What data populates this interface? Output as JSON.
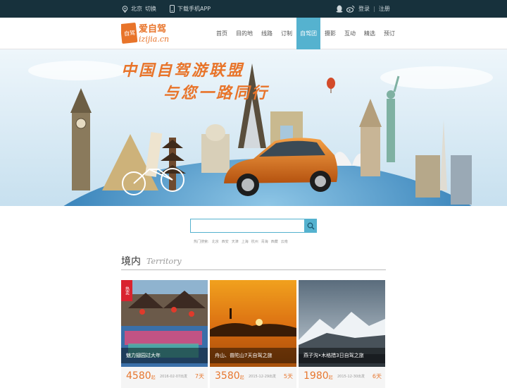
{
  "topbar": {
    "city": "北京",
    "switch": "切换",
    "app": "下载手机APP",
    "login": "登录",
    "divider": "|",
    "register": "注册"
  },
  "logo": {
    "cn": "爱自驾",
    "en": "izijia.cn",
    "badge": "自驾介"
  },
  "nav": {
    "items": [
      {
        "label": "首页",
        "active": false
      },
      {
        "label": "目的地",
        "active": false
      },
      {
        "label": "线路",
        "active": false
      },
      {
        "label": "订制",
        "active": false
      },
      {
        "label": "自驾团",
        "active": true
      },
      {
        "label": "摄影",
        "active": false
      },
      {
        "label": "互动",
        "active": false
      },
      {
        "label": "精选",
        "active": false
      },
      {
        "label": "预订",
        "active": false
      }
    ]
  },
  "banner": {
    "line1": "中国自驾游联盟",
    "line2": "与您一路同行"
  },
  "search": {
    "value": "",
    "placeholder": "",
    "hot_label": "热门搜索:",
    "hot_items": [
      "北京",
      "西安",
      "天津",
      "上海",
      "杭州",
      "青海",
      "西藏",
      "云南"
    ]
  },
  "section": {
    "title": "境内",
    "subtitle": "Territory"
  },
  "cards": [
    {
      "caption": "魅力翅园过大年",
      "price": "4580",
      "unit": "起",
      "date": "2016-02-07出发",
      "days": "7天",
      "tag": "热卖"
    },
    {
      "caption": "舟山、普陀山7天自驾之旅",
      "price": "3580",
      "unit": "起",
      "date": "2015-12-29出发",
      "days": "5天"
    },
    {
      "caption": "燕子沟•木格措3日自驾之旅",
      "price": "1980",
      "unit": "起",
      "date": "2015-12-30出发",
      "days": "6天"
    }
  ],
  "colors": {
    "accent": "#55b2cf",
    "orange": "#e8742a",
    "topbar": "#17313c"
  }
}
